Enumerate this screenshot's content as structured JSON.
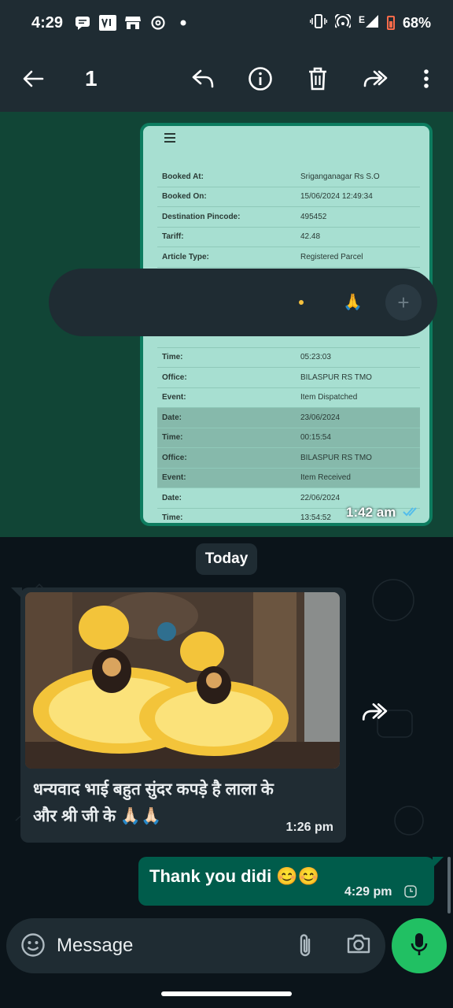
{
  "status_bar": {
    "time": "4:29",
    "network": "E",
    "battery": "68%"
  },
  "action_bar": {
    "selected_count": "1",
    "icons": [
      "back-arrow-icon",
      "reply-icon",
      "info-icon",
      "delete-icon",
      "forward-icon",
      "more-icon"
    ]
  },
  "document_preview": {
    "rows": [
      {
        "label": "Booked At:",
        "value": "Sriganganagar Rs S.O",
        "shaded": false
      },
      {
        "label": "Booked On:",
        "value": "15/06/2024 12:49:34",
        "shaded": false
      },
      {
        "label": "Destination Pincode:",
        "value": "495452",
        "shaded": false
      },
      {
        "label": "Tariff:",
        "value": "42.48",
        "shaded": false
      },
      {
        "label": "Article Type:",
        "value": "Registered Parcel",
        "shaded": false
      },
      {
        "label": "",
        "value": "",
        "shaded": false
      },
      {
        "label": "",
        "value": "",
        "shaded": false
      },
      {
        "label": "",
        "value": "",
        "shaded": false
      },
      {
        "label": "",
        "value": "",
        "shaded": false
      },
      {
        "label": "Time:",
        "value": "05:23:03",
        "shaded": false
      },
      {
        "label": "Office:",
        "value": "BILASPUR RS TMO",
        "shaded": false
      },
      {
        "label": "Event:",
        "value": "Item Dispatched",
        "shaded": false
      },
      {
        "label": "Date:",
        "value": "23/06/2024",
        "shaded": true
      },
      {
        "label": "Time:",
        "value": "00:15:54",
        "shaded": true
      },
      {
        "label": "Office:",
        "value": "BILASPUR RS TMO",
        "shaded": true
      },
      {
        "label": "Event:",
        "value": "Item Received",
        "shaded": true
      },
      {
        "label": "Date:",
        "value": "22/06/2024",
        "shaded": false
      },
      {
        "label": "Time:",
        "value": "13:54:52",
        "shaded": false
      }
    ],
    "time": "1:42 am"
  },
  "date_chip": "Today",
  "incoming_message": {
    "text_line1": "धन्यवाद भाई बहुत सुंदर कपड़े है लाला के",
    "text_line2": "और श्री जी के 🙏🏻🙏🏻",
    "time": "1:26 pm"
  },
  "outgoing_message": {
    "text": "Thank you didi 😊😊",
    "time": "4:29 pm"
  },
  "compose": {
    "placeholder": "Message"
  },
  "colors": {
    "header": "#1f2c33",
    "outgoing_bubble": "#005c4b",
    "incoming_bubble": "#202c33",
    "accent": "#21c063"
  }
}
